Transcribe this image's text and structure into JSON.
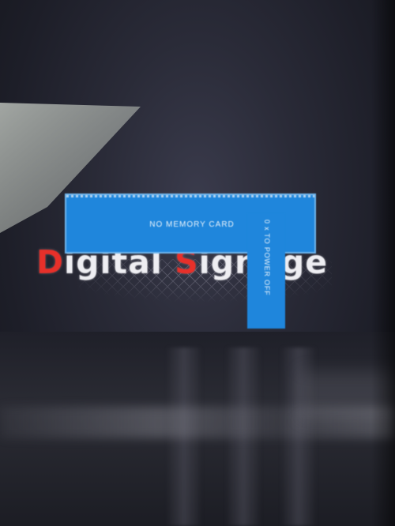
{
  "logo": {
    "letters": [
      {
        "text": "D",
        "accent": true
      },
      {
        "text": "igital ",
        "accent": false
      },
      {
        "text": "S",
        "accent": true
      },
      {
        "text": "ignage",
        "accent": false
      }
    ]
  },
  "osd": {
    "message": "NO MEMORY CARD",
    "side_hint": "0 x TO POWER OFF"
  },
  "colors": {
    "background": "#1b1c26",
    "osd_blue": "#1f86dc",
    "logo_white": "#eeeef2",
    "logo_accent": "#e7302a"
  }
}
